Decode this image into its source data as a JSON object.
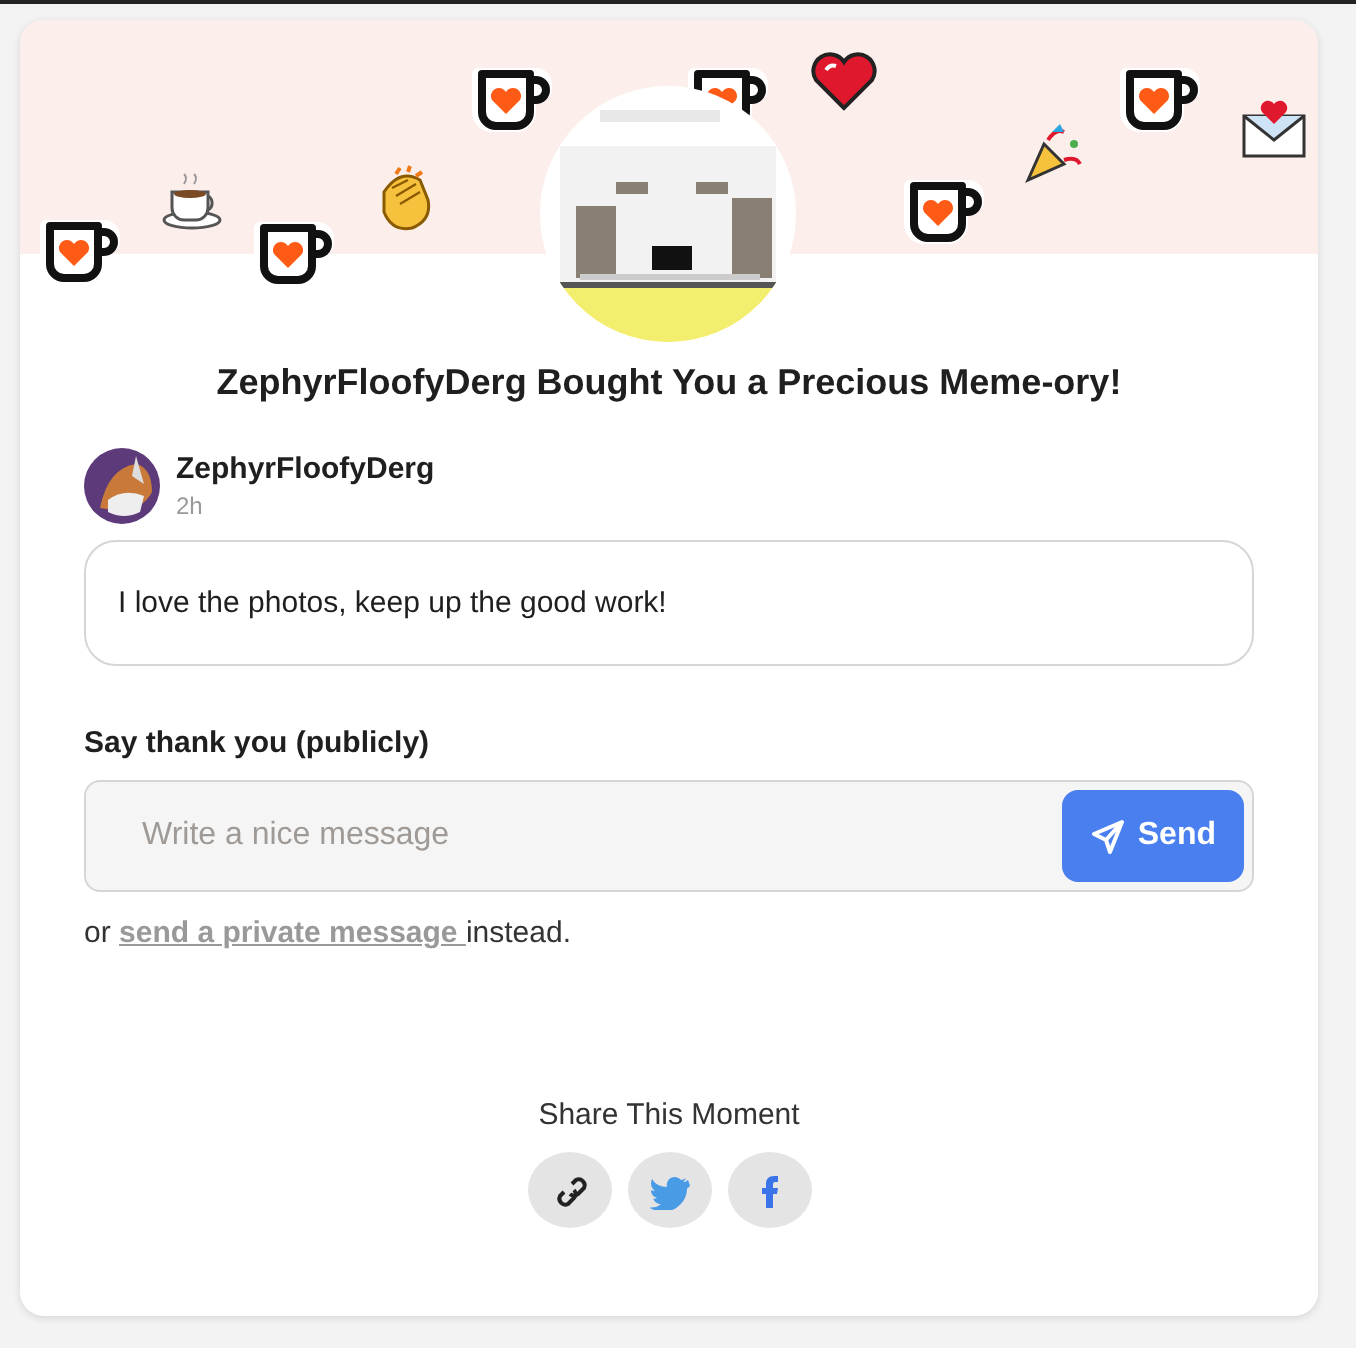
{
  "headline": "ZephyrFloofyDerg Bought You a Precious Meme-ory!",
  "sender": {
    "name": "ZephyrFloofyDerg",
    "time": "2h",
    "message": "I love the photos, keep up the good work!"
  },
  "reply": {
    "label": "Say thank you (publicly)",
    "placeholder": "Write a nice message",
    "button": "Send"
  },
  "private_note": {
    "before": "or",
    "link": "send a private message",
    "after": "instead."
  },
  "share": {
    "title": "Share This Moment",
    "buttons": [
      {
        "kind": "link"
      },
      {
        "kind": "twitter"
      },
      {
        "kind": "facebook"
      }
    ]
  }
}
